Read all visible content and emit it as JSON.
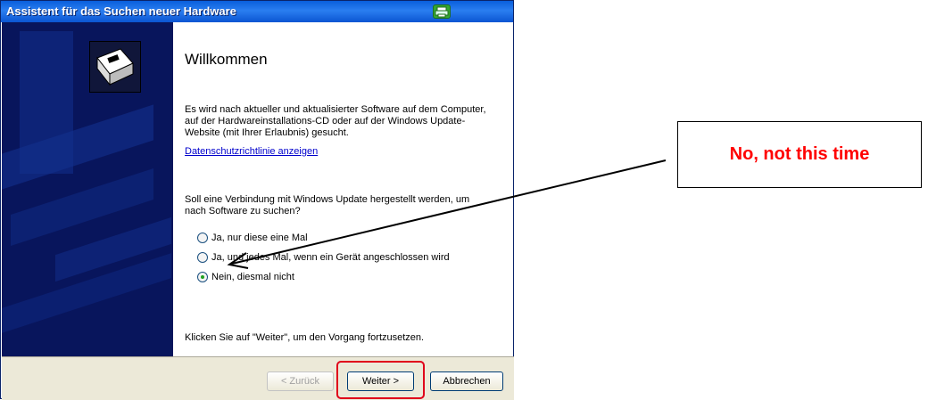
{
  "window": {
    "title": "Assistent für das Suchen neuer Hardware"
  },
  "content": {
    "heading": "Willkommen",
    "intro": "Es wird nach aktueller und aktualisierter Software auf dem Computer, auf der Hardwareinstallations-CD oder auf der Windows Update-Website (mit Ihrer Erlaubnis) gesucht.",
    "privacy_link": "Datenschutzrichtlinie anzeigen",
    "question": "Soll eine Verbindung mit Windows Update hergestellt werden, um nach Software zu suchen?",
    "options": [
      {
        "label": "Ja, nur diese eine Mal",
        "selected": false
      },
      {
        "label": "Ja, und jedes Mal, wenn ein Gerät angeschlossen wird",
        "selected": false
      },
      {
        "label": "Nein, diesmal nicht",
        "selected": true
      }
    ],
    "continue_hint": "Klicken Sie auf \"Weiter\", um den Vorgang fortzusetzen."
  },
  "buttons": {
    "back": "< Zurück",
    "next": "Weiter >",
    "cancel": "Abbrechen"
  },
  "annotation": {
    "callout_text": "No, not this time",
    "accent_color": "#ff0000"
  },
  "icons": [
    "hardware-wizard-icon",
    "printer-icon"
  ]
}
